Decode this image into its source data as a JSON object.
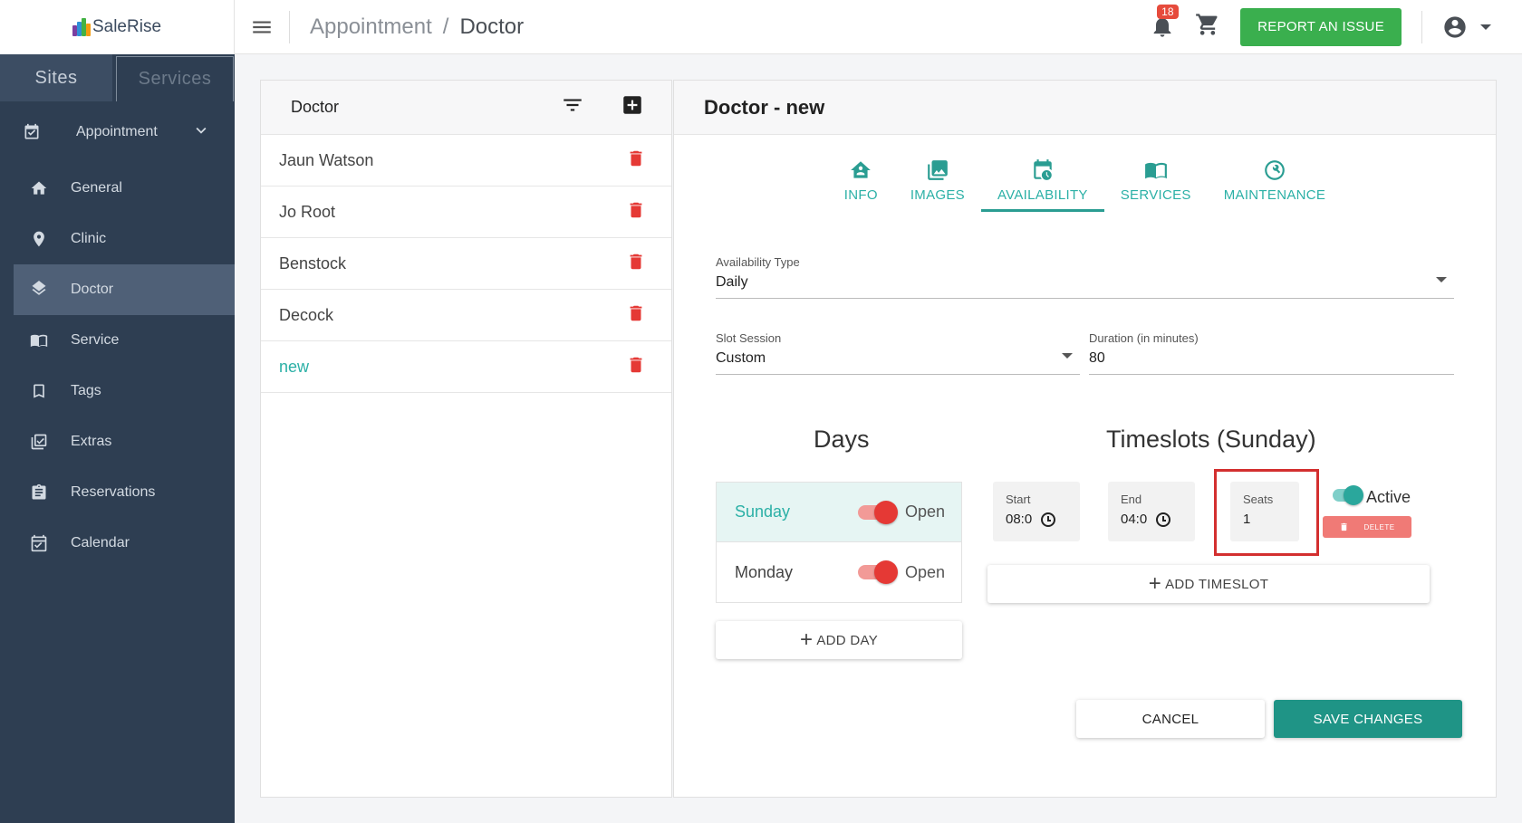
{
  "logo": {
    "text": "SaleRise"
  },
  "sidebar": {
    "tabs": [
      {
        "label": "Sites",
        "active": true
      },
      {
        "label": "Services",
        "active": false
      }
    ],
    "section": {
      "label": "Appointment",
      "icon": "calendar-check-icon"
    },
    "items": [
      {
        "label": "General",
        "icon": "home-icon"
      },
      {
        "label": "Clinic",
        "icon": "location-pin-icon"
      },
      {
        "label": "Doctor",
        "icon": "layers-icon",
        "active": true
      },
      {
        "label": "Service",
        "icon": "book-open-icon"
      },
      {
        "label": "Tags",
        "icon": "bookmark-icon"
      },
      {
        "label": "Extras",
        "icon": "checklist-icon"
      },
      {
        "label": "Reservations",
        "icon": "clipboard-icon"
      },
      {
        "label": "Calendar",
        "icon": "calendar-icon"
      }
    ]
  },
  "header": {
    "breadcrumb": {
      "parent": "Appointment",
      "separator": "/",
      "current": "Doctor"
    },
    "notification_count": "18",
    "report_label": "REPORT AN ISSUE"
  },
  "list": {
    "title": "Doctor",
    "items": [
      {
        "name": "Jaun Watson"
      },
      {
        "name": "Jo Root"
      },
      {
        "name": "Benstock"
      },
      {
        "name": "Decock"
      },
      {
        "name": "new",
        "selected": true
      }
    ]
  },
  "detail": {
    "title": "Doctor - new",
    "tabs": [
      {
        "label": "INFO",
        "icon": "house-icon"
      },
      {
        "label": "IMAGES",
        "icon": "images-icon"
      },
      {
        "label": "AVAILABILITY",
        "icon": "calendar-clock-icon",
        "active": true
      },
      {
        "label": "SERVICES",
        "icon": "book-icon"
      },
      {
        "label": "MAINTENANCE",
        "icon": "wrench-icon"
      }
    ],
    "availability_type": {
      "label": "Availability Type",
      "value": "Daily"
    },
    "slot_session": {
      "label": "Slot Session",
      "value": "Custom"
    },
    "duration": {
      "label": "Duration (in minutes)",
      "value": "80"
    },
    "days_title": "Days",
    "timeslots_title": "Timeslots (Sunday)",
    "days": [
      {
        "name": "Sunday",
        "state": "Open",
        "selected": true
      },
      {
        "name": "Monday",
        "state": "Open"
      }
    ],
    "add_day_label": "ADD DAY",
    "timeslot": {
      "start_label": "Start",
      "start_value": "08:0",
      "end_label": "End",
      "end_value": "04:0",
      "seats_label": "Seats",
      "seats_value": "1",
      "active_label": "Active",
      "delete_label": "DELETE"
    },
    "add_timeslot_label": "ADD TIMESLOT",
    "cancel_label": "CANCEL",
    "save_label": "SAVE CHANGES"
  },
  "colors": {
    "sidebar_bg": "#2e3e52",
    "accent_teal": "#2a9d92",
    "report_green": "#3aaf4e",
    "delete_red": "#e53935",
    "highlight_red": "#d32f2f"
  }
}
